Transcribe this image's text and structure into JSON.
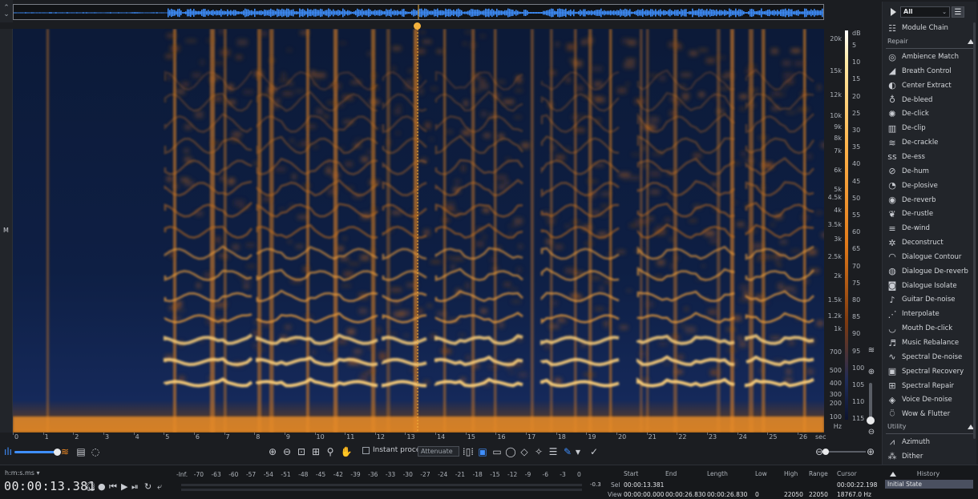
{
  "colors": {
    "accent": "#3f8fff",
    "playhead": "#f4b23d",
    "spectro_hot": "#ffb84a",
    "spectro_cold": "#0b1832"
  },
  "left_rail": {
    "label": "M"
  },
  "spectrogram": {
    "frequency_labels": [
      "20k",
      "15k",
      "12k",
      "10k",
      "9k",
      "8k",
      "7k",
      "6k",
      "5k",
      "4.5k",
      "4k",
      "3.5k",
      "3k",
      "2.5k",
      "2k",
      "1.5k",
      "1.2k",
      "1k",
      "700",
      "500",
      "400",
      "300",
      "200",
      "100",
      "Hz"
    ],
    "db_labels": [
      "dB",
      "5",
      "10",
      "15",
      "20",
      "25",
      "30",
      "35",
      "40",
      "45",
      "50",
      "55",
      "60",
      "65",
      "70",
      "75",
      "80",
      "85",
      "90",
      "95",
      "100",
      "105",
      "110",
      "115"
    ],
    "time_labels": [
      "0",
      "1",
      "2",
      "3",
      "4",
      "5",
      "6",
      "7",
      "8",
      "9",
      "10",
      "11",
      "12",
      "13",
      "14",
      "15",
      "16",
      "17",
      "18",
      "19",
      "20",
      "21",
      "22",
      "23",
      "24",
      "25",
      "26",
      "sec"
    ]
  },
  "toolbar": {
    "instant_process_label": "Instant process",
    "mode_select": "Attenuate"
  },
  "modules": {
    "filter_select": "All",
    "module_chain_label": "Module Chain",
    "repair_header": "Repair",
    "repair_items": [
      {
        "label": "Ambience Match",
        "icon": "ambience-match-icon",
        "glyph": "◎"
      },
      {
        "label": "Breath Control",
        "icon": "breath-control-icon",
        "glyph": "◢"
      },
      {
        "label": "Center Extract",
        "icon": "center-extract-icon",
        "glyph": "◐"
      },
      {
        "label": "De-bleed",
        "icon": "de-bleed-icon",
        "glyph": "♁"
      },
      {
        "label": "De-click",
        "icon": "de-click-icon",
        "glyph": "✺"
      },
      {
        "label": "De-clip",
        "icon": "de-clip-icon",
        "glyph": "▥"
      },
      {
        "label": "De-crackle",
        "icon": "de-crackle-icon",
        "glyph": "≋"
      },
      {
        "label": "De-ess",
        "icon": "de-ess-icon",
        "glyph": "ss"
      },
      {
        "label": "De-hum",
        "icon": "de-hum-icon",
        "glyph": "⊘"
      },
      {
        "label": "De-plosive",
        "icon": "de-plosive-icon",
        "glyph": "◔"
      },
      {
        "label": "De-reverb",
        "icon": "de-reverb-icon",
        "glyph": "◉"
      },
      {
        "label": "De-rustle",
        "icon": "de-rustle-icon",
        "glyph": "❦"
      },
      {
        "label": "De-wind",
        "icon": "de-wind-icon",
        "glyph": "≡"
      },
      {
        "label": "Deconstruct",
        "icon": "deconstruct-icon",
        "glyph": "✲"
      },
      {
        "label": "Dialogue Contour",
        "icon": "dialogue-contour-icon",
        "glyph": "◠"
      },
      {
        "label": "Dialogue De-reverb",
        "icon": "dialogue-de-reverb-icon",
        "glyph": "◍"
      },
      {
        "label": "Dialogue Isolate",
        "icon": "dialogue-isolate-icon",
        "glyph": "◙"
      },
      {
        "label": "Guitar De-noise",
        "icon": "guitar-de-noise-icon",
        "glyph": "♪"
      },
      {
        "label": "Interpolate",
        "icon": "interpolate-icon",
        "glyph": "⋰"
      },
      {
        "label": "Mouth De-click",
        "icon": "mouth-de-click-icon",
        "glyph": "◡"
      },
      {
        "label": "Music Rebalance",
        "icon": "music-rebalance-icon",
        "glyph": "♬"
      },
      {
        "label": "Spectral De-noise",
        "icon": "spectral-de-noise-icon",
        "glyph": "∿"
      },
      {
        "label": "Spectral Recovery",
        "icon": "spectral-recovery-icon",
        "glyph": "▣"
      },
      {
        "label": "Spectral Repair",
        "icon": "spectral-repair-icon",
        "glyph": "⊞"
      },
      {
        "label": "Voice De-noise",
        "icon": "voice-de-noise-icon",
        "glyph": "◈"
      },
      {
        "label": "Wow & Flutter",
        "icon": "wow-flutter-icon",
        "glyph": "⍥"
      }
    ],
    "utility_header": "Utility",
    "utility_items": [
      {
        "label": "Azimuth",
        "icon": "azimuth-icon",
        "glyph": "⩘"
      },
      {
        "label": "Dither",
        "icon": "dither-icon",
        "glyph": "⁂"
      }
    ]
  },
  "transport": {
    "time_format": "h:m:s.ms",
    "timecode": "00:00:13.381"
  },
  "meter": {
    "labels": [
      "-Inf.",
      "-70",
      "-63",
      "-60",
      "-57",
      "-54",
      "-51",
      "-48",
      "-45",
      "-42",
      "-39",
      "-36",
      "-33",
      "-30",
      "-27",
      "-24",
      "-21",
      "-18",
      "-15",
      "-12",
      "-9",
      "-6",
      "-3",
      "0"
    ],
    "peak": "-0.3"
  },
  "selection_info": {
    "row_labels": [
      "Sel",
      "View"
    ],
    "start_header": "Start",
    "end_header": "End",
    "length_header": "Length",
    "low_header": "Low",
    "high_header": "High",
    "range_header": "Range",
    "cursor_header": "Cursor",
    "sel_start": "00:00:13.381",
    "view_start": "00:00:00.000",
    "view_end": "00:00:26.830",
    "view_length": "00:00:26.830",
    "view_low": "0",
    "view_high": "22050",
    "view_range": "22050",
    "cursor_time": "00:00:22.198",
    "cursor_freq": "18767.0 Hz"
  },
  "history": {
    "header": "History",
    "items": [
      "Initial State"
    ]
  }
}
